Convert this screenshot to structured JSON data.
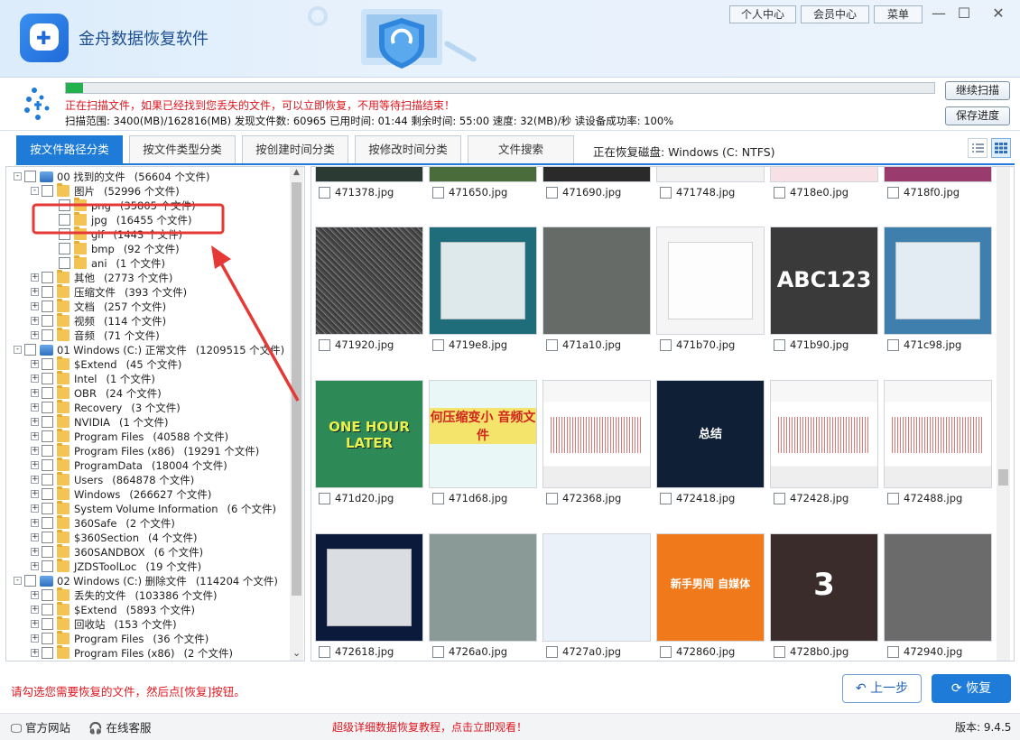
{
  "app": {
    "title": "金舟数据恢复软件",
    "version": "版本: 9.4.5"
  },
  "topbar": {
    "buttons": [
      "个人中心",
      "会员中心",
      "菜单"
    ],
    "window_controls": [
      "minimize-icon",
      "maximize-icon",
      "close-icon"
    ]
  },
  "scan": {
    "progress": 0.02,
    "message": "正在扫描文件，如果已经找到您丢失的文件，可以立即恢复，不用等待扫描结束！",
    "stats": "扫描范围: 3400(MB)/162816(MB)   发现文件数: 60965   已用时间: 01:44   剩余时间: 55:00   速度: 32(MB)/秒   读设备成功率: 100%",
    "continue_label": "继续扫描",
    "save_label": "保存进度"
  },
  "tabs": [
    {
      "label": "按文件路径分类",
      "active": true
    },
    {
      "label": "按文件类型分类",
      "active": false
    },
    {
      "label": "按创建时间分类",
      "active": false
    },
    {
      "label": "按修改时间分类",
      "active": false
    },
    {
      "label": "文件搜索",
      "active": false
    }
  ],
  "disk_info": "正在恢复磁盘: Windows (C: NTFS)",
  "tree": [
    {
      "level": 0,
      "type": "drive",
      "expander": "−",
      "name": "00 找到的文件",
      "count": "(56604 个文件)"
    },
    {
      "level": 1,
      "type": "folder",
      "expander": "−",
      "name": "图片",
      "count": "(52996 个文件)"
    },
    {
      "level": 2,
      "type": "folder",
      "expander": "",
      "name": "png",
      "count": "(35805 个文件)"
    },
    {
      "level": 2,
      "type": "folder",
      "expander": "",
      "name": "jpg",
      "count": "(16455 个文件)"
    },
    {
      "level": 2,
      "type": "folder",
      "expander": "",
      "name": "gif",
      "count": "(1443 个文件)"
    },
    {
      "level": 2,
      "type": "folder",
      "expander": "",
      "name": "bmp",
      "count": "(92 个文件)"
    },
    {
      "level": 2,
      "type": "folder",
      "expander": "",
      "name": "ani",
      "count": "(1 个文件)"
    },
    {
      "level": 1,
      "type": "folder",
      "expander": "+",
      "name": "其他",
      "count": "(2773 个文件)"
    },
    {
      "level": 1,
      "type": "folder",
      "expander": "+",
      "name": "压缩文件",
      "count": "(393 个文件)"
    },
    {
      "level": 1,
      "type": "folder",
      "expander": "+",
      "name": "文档",
      "count": "(257 个文件)"
    },
    {
      "level": 1,
      "type": "folder",
      "expander": "+",
      "name": "视频",
      "count": "(114 个文件)"
    },
    {
      "level": 1,
      "type": "folder",
      "expander": "+",
      "name": "音频",
      "count": "(71 个文件)"
    },
    {
      "level": 0,
      "type": "drive",
      "expander": "−",
      "name": "01 Windows (C:) 正常文件",
      "count": "(1209515 个文件)"
    },
    {
      "level": 1,
      "type": "folder",
      "expander": "+",
      "name": "$Extend",
      "count": "(45 个文件)"
    },
    {
      "level": 1,
      "type": "folder",
      "expander": "+",
      "name": "Intel",
      "count": "(1 个文件)"
    },
    {
      "level": 1,
      "type": "folder",
      "expander": "+",
      "name": "OBR",
      "count": "(24 个文件)"
    },
    {
      "level": 1,
      "type": "folder",
      "expander": "+",
      "name": "Recovery",
      "count": "(3 个文件)"
    },
    {
      "level": 1,
      "type": "folder",
      "expander": "+",
      "name": "NVIDIA",
      "count": "(1 个文件)"
    },
    {
      "level": 1,
      "type": "folder",
      "expander": "+",
      "name": "Program Files",
      "count": "(40588 个文件)"
    },
    {
      "level": 1,
      "type": "folder",
      "expander": "+",
      "name": "Program Files (x86)",
      "count": "(19291 个文件)"
    },
    {
      "level": 1,
      "type": "folder",
      "expander": "+",
      "name": "ProgramData",
      "count": "(18004 个文件)"
    },
    {
      "level": 1,
      "type": "folder",
      "expander": "+",
      "name": "Users",
      "count": "(864878 个文件)"
    },
    {
      "level": 1,
      "type": "folder",
      "expander": "+",
      "name": "Windows",
      "count": "(266627 个文件)"
    },
    {
      "level": 1,
      "type": "folder",
      "expander": "+",
      "name": "System Volume Information",
      "count": "(6 个文件)"
    },
    {
      "level": 1,
      "type": "folder",
      "expander": "+",
      "name": "360Safe",
      "count": "(2 个文件)"
    },
    {
      "level": 1,
      "type": "folder",
      "expander": "+",
      "name": "$360Section",
      "count": "(4 个文件)"
    },
    {
      "level": 1,
      "type": "folder",
      "expander": "+",
      "name": "360SANDBOX",
      "count": "(6 个文件)"
    },
    {
      "level": 1,
      "type": "folder",
      "expander": "+",
      "name": "JZDSToolLoc",
      "count": "(19 个文件)"
    },
    {
      "level": 0,
      "type": "drive",
      "expander": "−",
      "name": "02 Windows (C:) 删除文件",
      "count": "(114204 个文件)"
    },
    {
      "level": 1,
      "type": "folder",
      "expander": "+",
      "name": "丢失的文件",
      "count": "(103386 个文件)"
    },
    {
      "level": 1,
      "type": "folder",
      "expander": "+",
      "name": "$Extend",
      "count": "(5893 个文件)"
    },
    {
      "level": 1,
      "type": "folder",
      "expander": "+",
      "name": "回收站",
      "count": "(153 个文件)"
    },
    {
      "level": 1,
      "type": "folder",
      "expander": "+",
      "name": "Program Files",
      "count": "(36 个文件)"
    },
    {
      "level": 1,
      "type": "folder",
      "expander": "+",
      "name": "Program Files (x86)",
      "count": "(2 个文件)"
    }
  ],
  "files": [
    {
      "name": "471378.jpg",
      "thumb": "dark-image-thumbnail",
      "bg": "#2b3a33"
    },
    {
      "name": "471650.jpg",
      "thumb": "photo-thumbnail",
      "bg": "#4a6b3a"
    },
    {
      "name": "471690.jpg",
      "thumb": "dark-image-thumbnail",
      "bg": "#2a2a2a"
    },
    {
      "name": "471748.jpg",
      "thumb": "white-image-thumbnail",
      "bg": "#f2f2f2"
    },
    {
      "name": "4718e0.jpg",
      "thumb": "pink-image-thumbnail",
      "bg": "#f7e1e6"
    },
    {
      "name": "4718f0.jpg",
      "thumb": "purple-image-thumbnail",
      "bg": "#9a3b6e"
    },
    {
      "name": "471920.jpg",
      "thumb": "noise-texture-thumbnail",
      "bg": "#555555"
    },
    {
      "name": "4719e8.jpg",
      "thumb": "app-screenshot-thumbnail",
      "bg": "#1f6d7a"
    },
    {
      "name": "471a10.jpg",
      "thumb": "gray-image-thumbnail",
      "bg": "#666b68"
    },
    {
      "name": "471b70.jpg",
      "thumb": "webpage-screenshot-thumbnail",
      "bg": "#f5f5f5"
    },
    {
      "name": "471b90.jpg",
      "thumb": "text-image-thumbnail",
      "bg": "#3a3a3a",
      "text": "ABC123"
    },
    {
      "name": "471c98.jpg",
      "thumb": "desktop-screenshot-thumbnail",
      "bg": "#3e7fae"
    },
    {
      "name": "471d20.jpg",
      "thumb": "cartoon-title-thumbnail",
      "bg": "#2d8a57",
      "text": "ONE HOUR LATER"
    },
    {
      "name": "471d68.jpg",
      "thumb": "poster-thumbnail",
      "bg": "#e9f7f7",
      "text": "何压缩变小 音频文件"
    },
    {
      "name": "472368.jpg",
      "thumb": "audio-editor-thumbnail",
      "bg": "#f3f3f3"
    },
    {
      "name": "472418.jpg",
      "thumb": "dark-slide-thumbnail",
      "bg": "#0f1f35",
      "text": "总结"
    },
    {
      "name": "472428.jpg",
      "thumb": "audio-editor-thumbnail",
      "bg": "#f3f3f3"
    },
    {
      "name": "472488.jpg",
      "thumb": "audio-editor-thumbnail",
      "bg": "#f3f3f3"
    },
    {
      "name": "472618.jpg",
      "thumb": "desktop-screenshot-thumbnail",
      "bg": "#0b1a3a"
    },
    {
      "name": "4726a0.jpg",
      "thumb": "illustration-thumbnail",
      "bg": "#8a9a97"
    },
    {
      "name": "4727a0.jpg",
      "thumb": "illustration-thumbnail",
      "bg": "#eaf1f8"
    },
    {
      "name": "472860.jpg",
      "thumb": "orange-banner-thumbnail",
      "bg": "#f07a1b",
      "text": "新手男闯 自媒体"
    },
    {
      "name": "4728b0.jpg",
      "thumb": "countdown-thumbnail",
      "bg": "#3a2c2a",
      "text": "3"
    },
    {
      "name": "472940.jpg",
      "thumb": "gray-image-thumbnail",
      "bg": "#6b6b6b"
    }
  ],
  "footer": {
    "hint": "请勾选您需要恢复的文件，然后点[恢复]按钮。",
    "prev_label": "上一步",
    "recover_label": "恢复",
    "site_label": "官方网站",
    "service_label": "在线客服",
    "tutorial": "超级详细数据恢复教程，点击立即观看！"
  },
  "colors": {
    "accent": "#1e7cd8",
    "warning": "#e0161f",
    "progress": "#22b14c",
    "annotation": "#e53935"
  }
}
